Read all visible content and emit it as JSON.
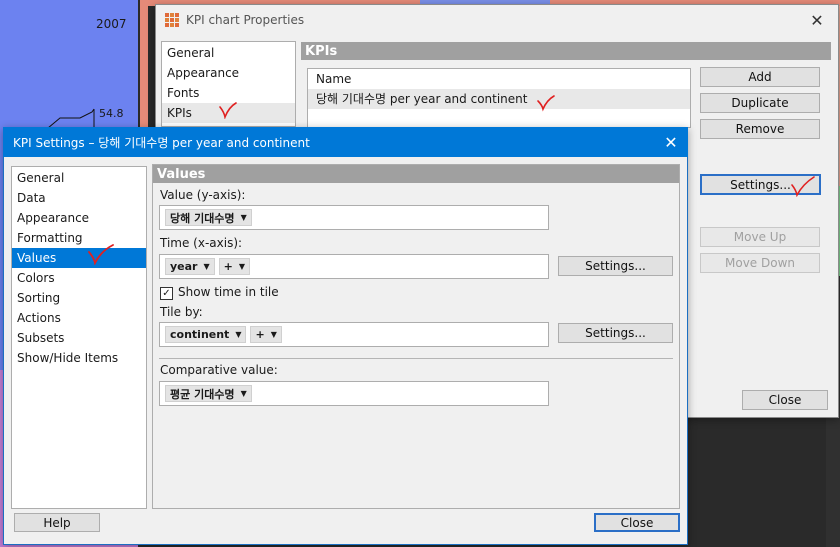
{
  "background": {
    "year_label": "2007",
    "value_label": "54.8"
  },
  "properties_dialog": {
    "title": "KPI chart Properties",
    "nav": [
      "General",
      "Appearance",
      "Fonts",
      "KPIs"
    ],
    "section_header": "KPIs",
    "list_header": "Name",
    "kpi_item": "당해 기대수명 per year and continent",
    "buttons": {
      "add": "Add",
      "duplicate": "Duplicate",
      "remove": "Remove",
      "settings": "Settings...",
      "move_up": "Move Up",
      "move_down": "Move Down",
      "close": "Close"
    }
  },
  "settings_dialog": {
    "title": "KPI Settings – 당해 기대수명 per year and continent",
    "nav": [
      "General",
      "Data",
      "Appearance",
      "Formatting",
      "Values",
      "Colors",
      "Sorting",
      "Actions",
      "Subsets",
      "Show/Hide Items"
    ],
    "selected_nav": "Values",
    "section_header": "Values",
    "value_label": "Value (y-axis):",
    "value_chip": "당해 기대수명",
    "time_label": "Time (x-axis):",
    "time_chip": "year",
    "time_plus": "+",
    "time_settings": "Settings...",
    "show_time_label": "Show time in tile",
    "show_time_checked": true,
    "tile_label": "Tile by:",
    "tile_chip": "continent",
    "tile_plus": "+",
    "tile_settings": "Settings...",
    "comparative_label": "Comparative value:",
    "comparative_chip": "평균 기대수명",
    "help": "Help",
    "close": "Close"
  },
  "colors": {
    "accent": "#0078d7",
    "annotation": "#e02020",
    "section_header": "#a0a0a0"
  }
}
